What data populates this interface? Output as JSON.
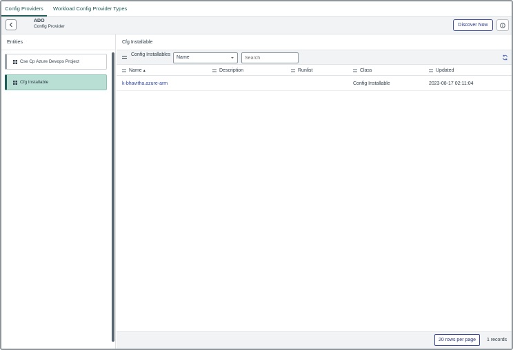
{
  "tabs": [
    {
      "label": "Config Providers",
      "active": true
    },
    {
      "label": "Workload Config Provider Types",
      "active": false
    }
  ],
  "header": {
    "title": "ADO",
    "subtitle": "Config Provider",
    "discover_label": "Discover Now"
  },
  "left_panel": {
    "title": "Entities",
    "items": [
      {
        "label": "Cse Cp Azure Devops Project",
        "selected": false
      },
      {
        "label": "Cfg Installable",
        "selected": true
      }
    ]
  },
  "main": {
    "title": "Cfg Installable",
    "toolbar": {
      "label": "Config Installables",
      "select_value": "Name",
      "search_placeholder": "Search"
    },
    "columns": [
      "Name",
      "Description",
      "Runlist",
      "Class",
      "Updated"
    ],
    "sort_indicator": "▴",
    "rows": [
      {
        "name": "k-bhavitha.azure-arm",
        "description": "",
        "runlist": "",
        "class": "Config Installable",
        "updated": "2023-08-17 02:11:04"
      }
    ],
    "footer": {
      "rows_per_page_label": "20 rows per page",
      "records_label": "1 records"
    }
  },
  "colors": {
    "accent": "#1f5b57",
    "selected_bg": "#b9dfd5",
    "link": "#2b47b0",
    "button_border": "#3a4aa0"
  }
}
